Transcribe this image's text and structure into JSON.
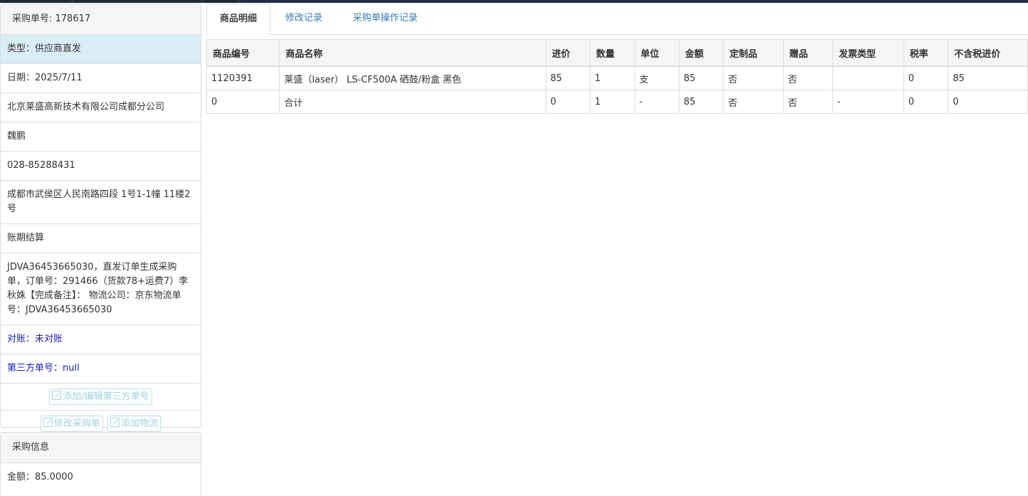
{
  "sidebar": {
    "header": "采购单号: 178617",
    "type": "类型：供应商直发",
    "date": "日期：2025/7/11",
    "company": "北京莱盛高新技术有限公司成都分公司",
    "contact": "魏鹏",
    "phone": "028-85288431",
    "address": "成都市武侯区人民南路四段 1号1-1幢 11楼2号",
    "settlement": "账期结算",
    "remark": "JDVA36453665030，直发订单生成采购单，订单号：291466（货款78+运费7）李秋姝【完成备注】： 物流公司：京东物流单号：JDVA36453665030",
    "reconcile": "对账：未对账",
    "third_party": "第三方单号：null",
    "btn_third_party": "添加/编辑第三方单号",
    "btn_edit_po": "修改采购单",
    "btn_add_logistics": "添加物流"
  },
  "purchase_info": {
    "header": "采购信息",
    "amount": "金额：85.0000"
  },
  "tabs": [
    "商品明细",
    "修改记录",
    "采购单操作记录"
  ],
  "table": {
    "headers": [
      "商品编号",
      "商品名称",
      "进价",
      "数量",
      "单位",
      "金额",
      "定制品",
      "赠品",
      "发票类型",
      "税率",
      "不含税进价"
    ],
    "rows": [
      [
        "1120391",
        "莱盛（laser） LS-CF500A 硒鼓/粉盒 黑色",
        "85",
        "1",
        "支",
        "85",
        "否",
        "否",
        "",
        "0",
        "85"
      ],
      [
        "0",
        "合计",
        "0",
        "1",
        "-",
        "85",
        "否",
        "否",
        "-",
        "0",
        "0"
      ]
    ]
  }
}
